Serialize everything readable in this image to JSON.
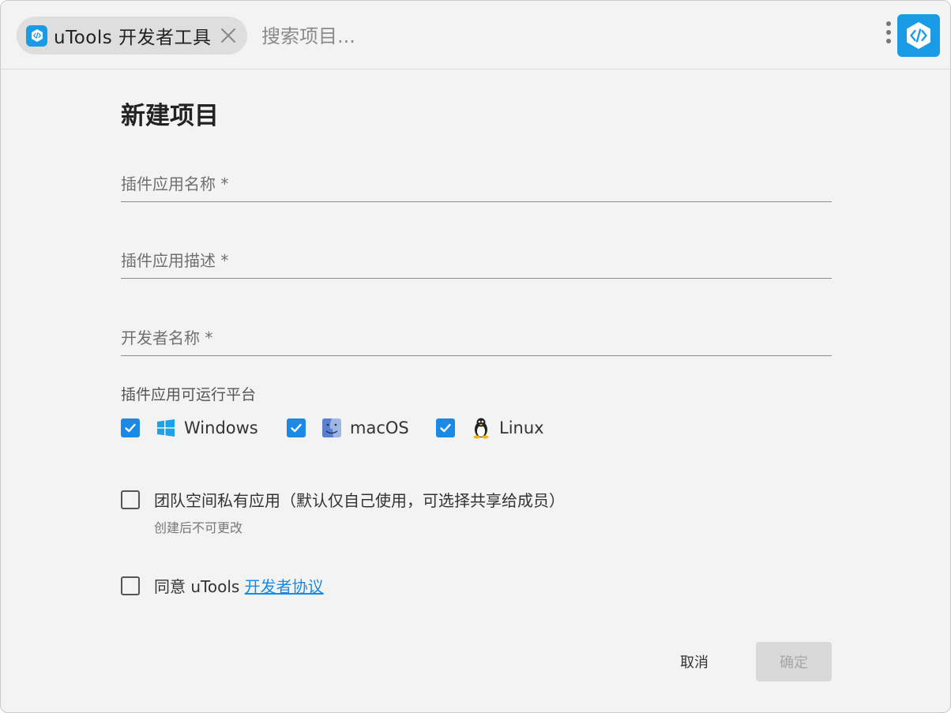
{
  "topbar": {
    "plugin_name": "uTools 开发者工具",
    "search_placeholder": "搜索项目..."
  },
  "form": {
    "title": "新建项目",
    "fields": [
      {
        "placeholder": "插件应用名称 *"
      },
      {
        "placeholder": "插件应用描述 *"
      },
      {
        "placeholder": "开发者名称 *"
      }
    ],
    "platforms_label": "插件应用可运行平台",
    "platforms": [
      {
        "label": "Windows",
        "checked": true,
        "icon": "windows-icon"
      },
      {
        "label": "macOS",
        "checked": true,
        "icon": "macos-finder-icon"
      },
      {
        "label": "Linux",
        "checked": true,
        "icon": "linux-tux-icon"
      }
    ],
    "team_private": {
      "label": "团队空间私有应用（默认仅自己使用，可选择共享给成员）",
      "hint": "创建后不可更改",
      "checked": false
    },
    "agree": {
      "prefix": "同意 uTools ",
      "link": "开发者协议",
      "checked": false
    }
  },
  "actions": {
    "cancel": "取消",
    "confirm": "确定"
  },
  "colors": {
    "accent": "#1a8ae6",
    "logo": "#1a9be6",
    "background": "#f3f3f3",
    "disabled_button": "#d9d9d9"
  }
}
